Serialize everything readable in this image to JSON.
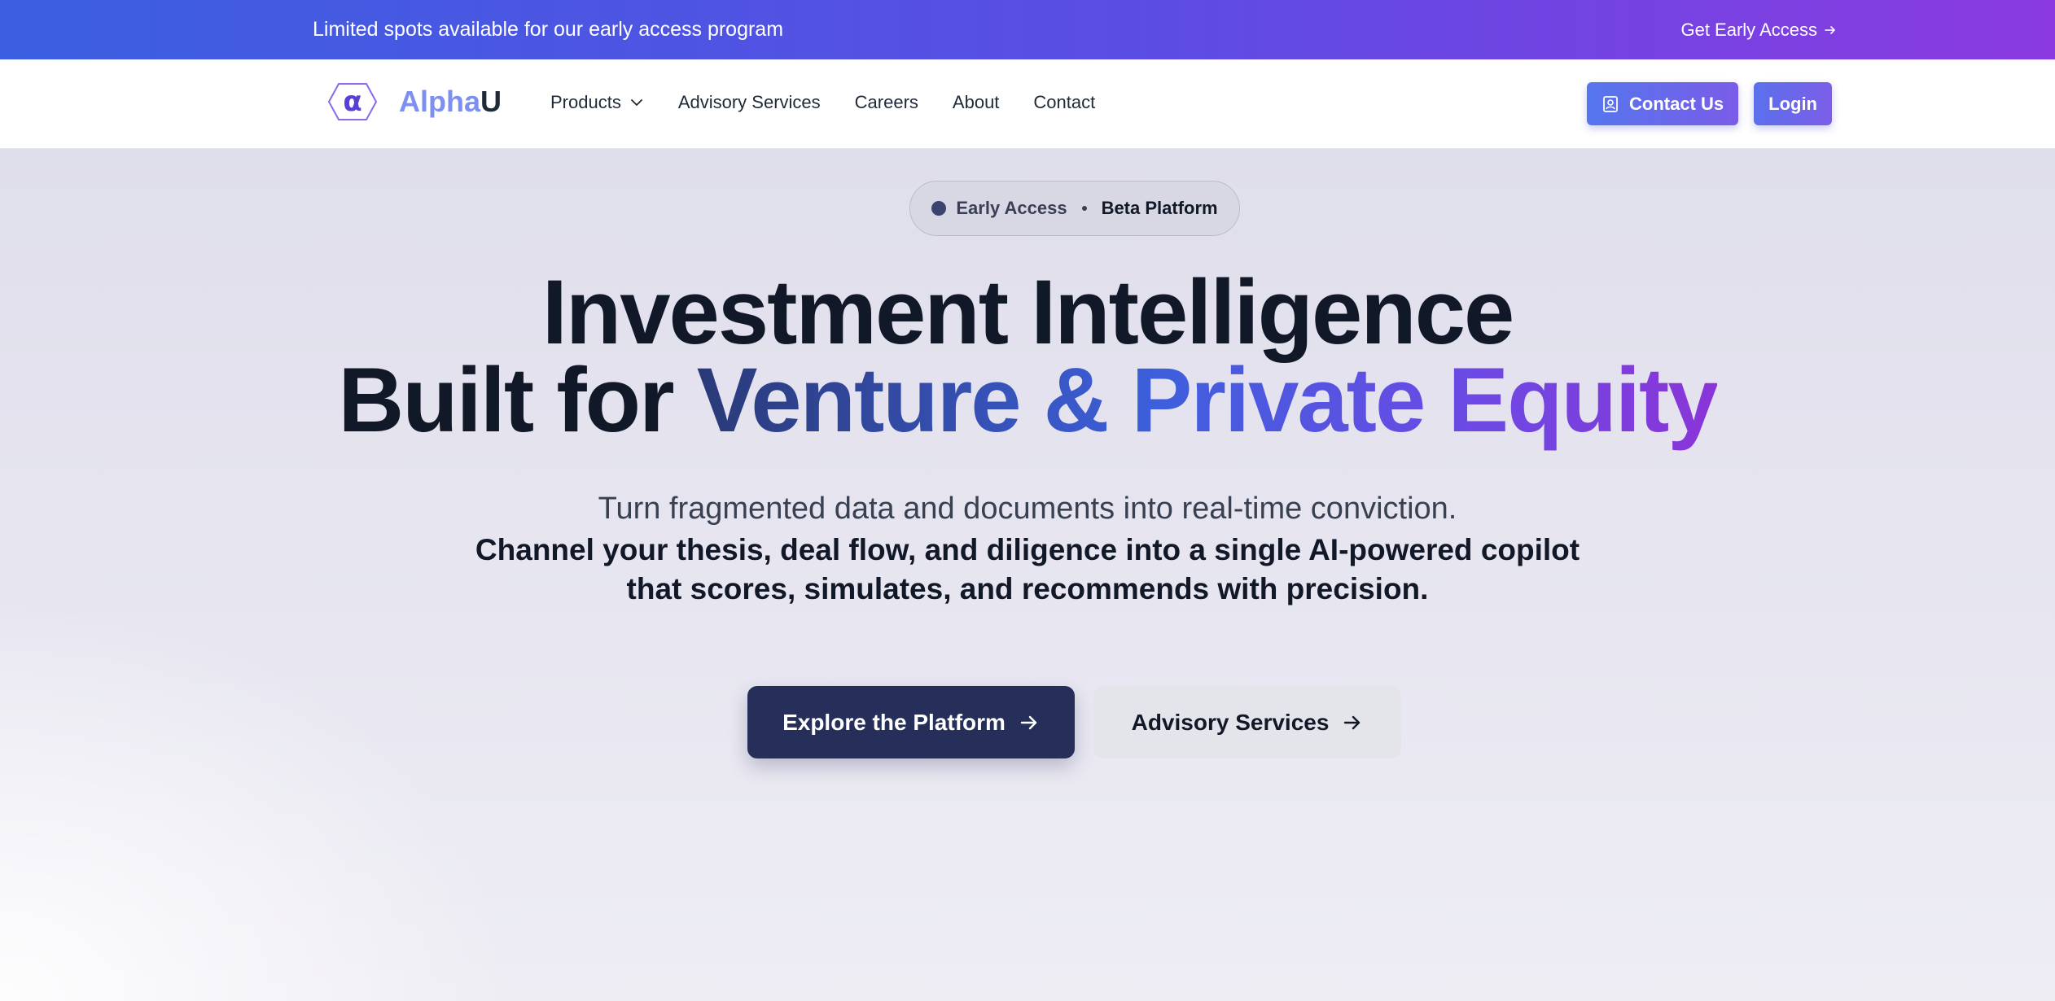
{
  "banner": {
    "message": "Limited spots available for our early access program",
    "link_label": "Get Early Access",
    "link_icon": "arrow-right-icon"
  },
  "brand": {
    "logo_glyph": "α",
    "name_part1": "Alpha",
    "name_part2": "U",
    "colors": {
      "alpha": "#7d8ff0",
      "u": "#1f2937",
      "hex_stroke": "#8b6ae8"
    }
  },
  "nav": {
    "products": "Products",
    "products_icon": "chevron-down-icon",
    "advisory": "Advisory Services",
    "careers": "Careers",
    "about": "About",
    "contact": "Contact",
    "contact_us_button": "Contact Us",
    "contact_us_icon": "contact-card-icon",
    "login_button": "Login"
  },
  "hero": {
    "badge_label": "Early Access",
    "badge_beta": "Beta Platform",
    "headline_line1": "Investment Intelligence",
    "headline_line2_prefix": "Built for",
    "headline_line2_gradient": "Venture & Private Equity",
    "subtitle": "Turn fragmented data and documents into real-time conviction.",
    "body_line1": "Channel your thesis, deal flow, and diligence into a single AI-powered copilot",
    "body_line2": "that scores, simulates, and recommends with precision.",
    "primary_cta": "Explore the Platform",
    "secondary_cta": "Advisory Services",
    "cta_icon": "arrow-right-icon"
  },
  "colors": {
    "banner_gradient_start": "#3b5fe0",
    "banner_gradient_end": "#8a3ae0",
    "primary_cta_bg": "#262f5a",
    "accent_blue": "#3d5fdc",
    "accent_purple": "#8a35d8"
  }
}
